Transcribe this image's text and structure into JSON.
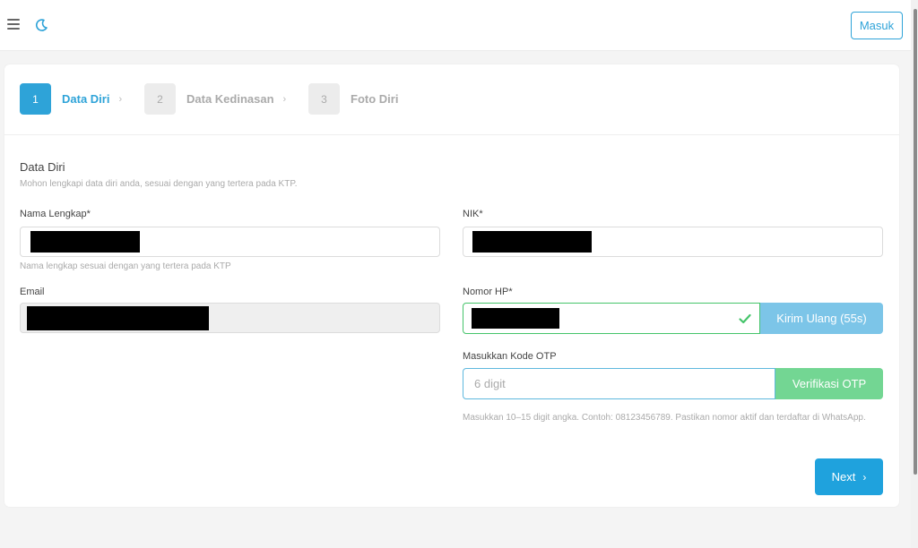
{
  "header": {
    "login_label": "Masuk"
  },
  "stepper": {
    "steps": [
      {
        "number": "1",
        "label": "Data Diri",
        "separator": "›",
        "state": "active"
      },
      {
        "number": "2",
        "label": "Data Kedinasan",
        "separator": "›",
        "state": "inactive"
      },
      {
        "number": "3",
        "label": "Foto Diri",
        "separator": "",
        "state": "inactive"
      }
    ]
  },
  "form": {
    "section_title": "Data Diri",
    "section_subtitle": "Mohon lengkapi data diri anda, sesuai dengan yang tertera pada KTP.",
    "full_name": {
      "label": "Nama Lengkap*",
      "hint": "Nama lengkap sesuai dengan yang tertera pada KTP"
    },
    "nik": {
      "label": "NIK*"
    },
    "email": {
      "label": "Email"
    },
    "phone": {
      "label": "Nomor HP*",
      "resend_label": "Kirim Ulang (55s)"
    },
    "otp": {
      "label": "Masukkan Kode OTP",
      "placeholder": "6 digit",
      "verify_label": "Verifikasi OTP",
      "hint": "Masukkan 10–15 digit angka. Contoh: 08123456789. Pastikan nomor aktif dan terdaftar di WhatsApp."
    },
    "next_label": "Next",
    "next_chevron": "›"
  },
  "colors": {
    "accent": "#2ea3d8",
    "success": "#45c46a",
    "resend_button": "#7cc5e8",
    "verify_button": "#73d693"
  },
  "icons": [
    "menu-icon",
    "moon-icon",
    "check-icon",
    "chevron-right-icon"
  ]
}
